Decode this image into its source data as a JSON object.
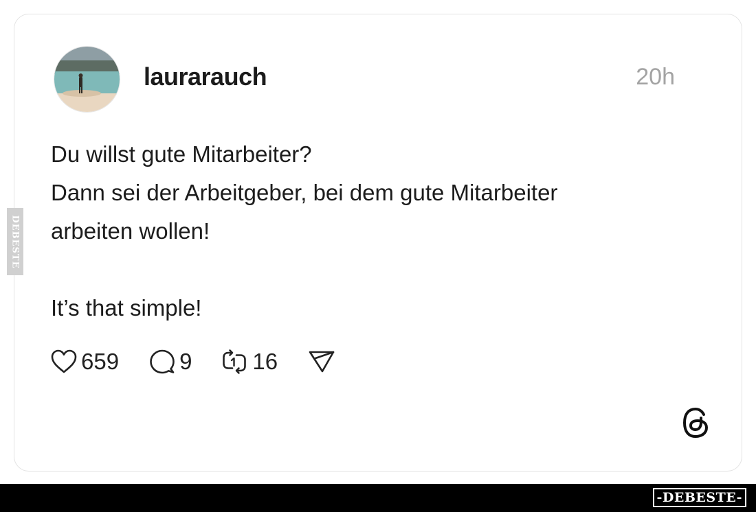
{
  "post": {
    "username": "laurarauch",
    "time": "20h",
    "avatar_icon": "profile-photo-beach",
    "lines": [
      "Du willst gute Mitarbeiter?",
      "Dann sei der Arbeitgeber, bei dem gute Mitarbeiter",
      "arbeiten wollen!",
      "",
      "It’s that simple!"
    ]
  },
  "actions": {
    "likes": "659",
    "replies": "9",
    "reposts": "16",
    "like_icon": "heart-icon",
    "reply_icon": "comment-icon",
    "repost_icon": "repost-icon",
    "share_icon": "send-icon"
  },
  "branding": {
    "app_logo": "threads-logo",
    "side_watermark": "DEBESTE",
    "bottom_watermark": "-DEBESTE-"
  },
  "colors": {
    "text": "#1c1c1c",
    "muted": "#a3a3a3",
    "border": "#e3e3e3",
    "bottom_bar": "#000000"
  }
}
